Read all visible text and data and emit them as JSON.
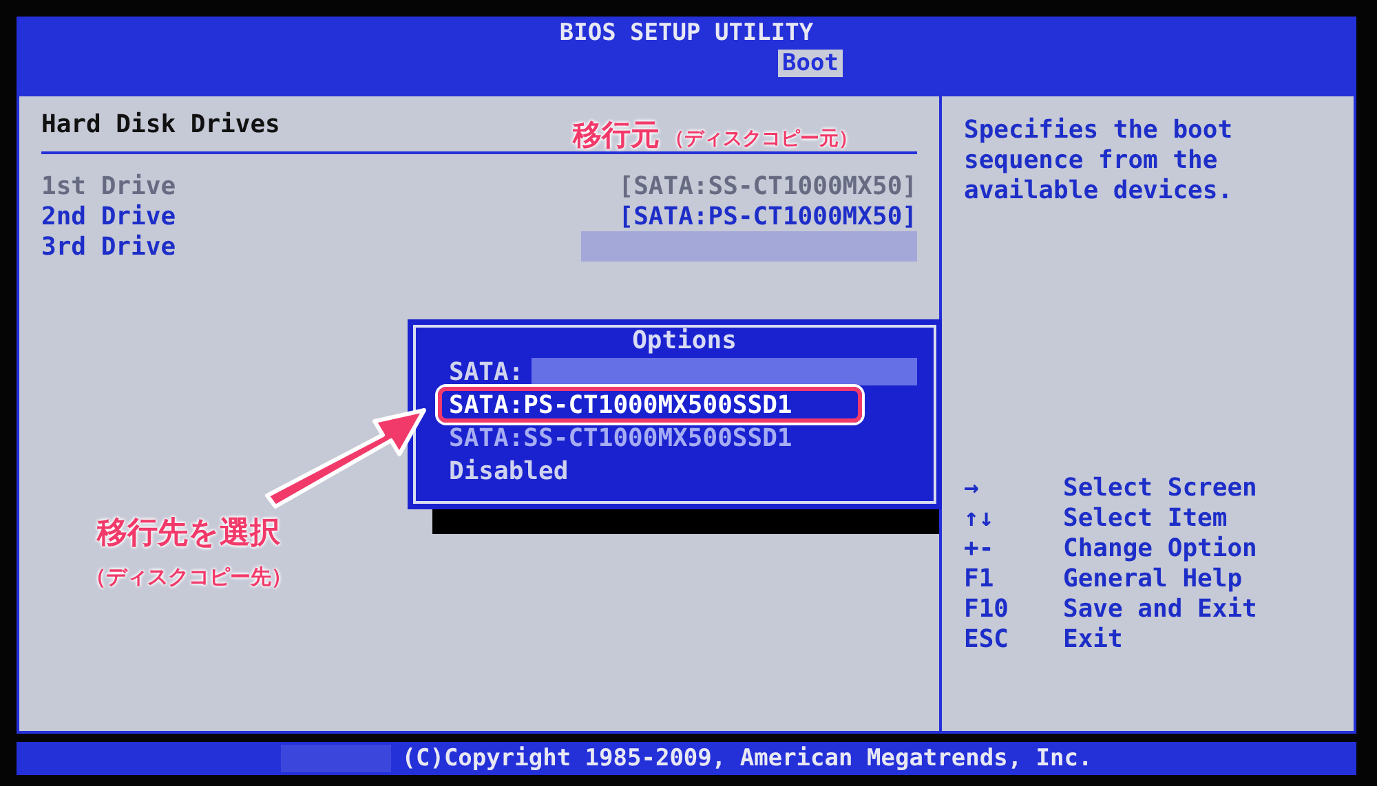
{
  "title": "BIOS SETUP UTILITY",
  "tabs": [
    {
      "label": "Boot",
      "selected": true
    }
  ],
  "section": {
    "heading": "Hard Disk Drives",
    "drives": [
      {
        "label": "1st Drive",
        "value": "[SATA:SS-CT1000MX50]",
        "disabled": true,
        "redacted": false
      },
      {
        "label": "2nd Drive",
        "value": "[SATA:PS-CT1000MX50]",
        "disabled": false,
        "redacted": false
      },
      {
        "label": "3rd Drive",
        "disabled": false,
        "redacted": true
      }
    ]
  },
  "help": "Specifies the boot sequence from the available devices.",
  "keys": [
    {
      "key": "→",
      "action": "Select Screen"
    },
    {
      "key": "↑↓",
      "action": "Select Item"
    },
    {
      "key": "+-",
      "action": "Change Option"
    },
    {
      "key": "F1",
      "action": "General Help"
    },
    {
      "key": "F10",
      "action": "Save and Exit"
    },
    {
      "key": "ESC",
      "action": "Exit"
    }
  ],
  "options_popup": {
    "title": "Options",
    "items": [
      {
        "label": "SATA:",
        "redacted": true,
        "selected": false,
        "disabled": false
      },
      {
        "label": "SATA:PS-CT1000MX500SSD1",
        "redacted": false,
        "selected": true,
        "disabled": false
      },
      {
        "label": "SATA:SS-CT1000MX500SSD1",
        "redacted": false,
        "selected": false,
        "disabled": true
      },
      {
        "label": "Disabled",
        "redacted": false,
        "selected": false,
        "disabled": false
      }
    ]
  },
  "footer": "(C)Copyright 1985-2009, American Megatrends, Inc.",
  "annotations": [
    {
      "kind": "source",
      "text": "移行元",
      "note": "（ディスクコピー元）"
    },
    {
      "kind": "target",
      "text": "移行先を選択",
      "note": "（ディスクコピー先）"
    }
  ]
}
